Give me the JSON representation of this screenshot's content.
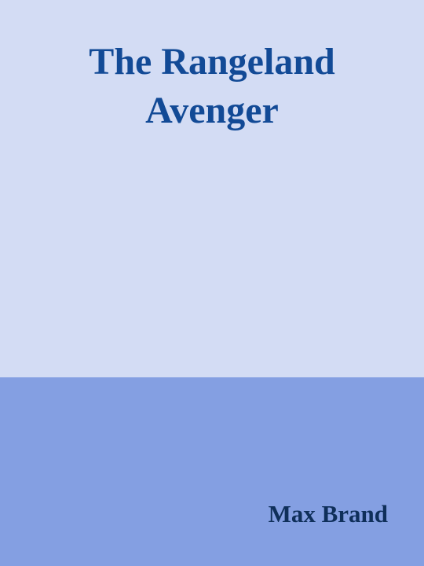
{
  "cover": {
    "title_lines": [
      "The Rangeland",
      "Avenger"
    ],
    "author": "Max Brand",
    "colors": {
      "top_panel": "#d3dcf4",
      "bottom_panel": "#849fe2",
      "title_text": "#124a96",
      "author_text": "#0f2f5a"
    }
  }
}
